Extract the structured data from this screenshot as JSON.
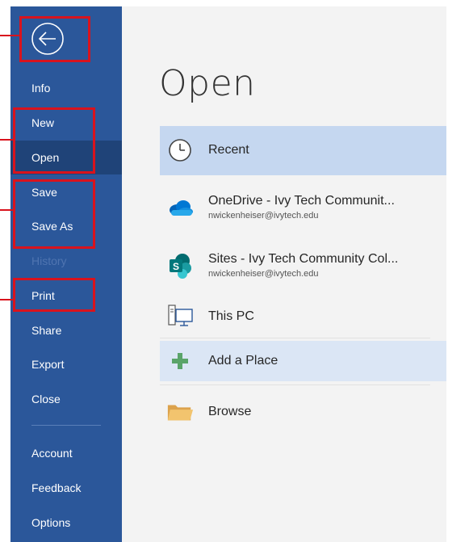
{
  "sidebar": {
    "back_label": "Back",
    "items": [
      {
        "label": "Info"
      },
      {
        "label": "New"
      },
      {
        "label": "Open"
      },
      {
        "label": "Save"
      },
      {
        "label": "Save As"
      },
      {
        "label": "History"
      },
      {
        "label": "Print"
      },
      {
        "label": "Share"
      },
      {
        "label": "Export"
      },
      {
        "label": "Close"
      },
      {
        "label": "Account"
      },
      {
        "label": "Feedback"
      },
      {
        "label": "Options"
      }
    ]
  },
  "main": {
    "title": "Open",
    "locations": [
      {
        "name": "Recent",
        "sub": "",
        "icon": "clock-icon"
      },
      {
        "name": "OneDrive - Ivy Tech Communit...",
        "sub": "nwickenheiser@ivytech.edu",
        "icon": "onedrive-cloud-icon"
      },
      {
        "name": "Sites - Ivy Tech Community Col...",
        "sub": "nwickenheiser@ivytech.edu",
        "icon": "sharepoint-icon"
      },
      {
        "name": "This PC",
        "sub": "",
        "icon": "computer-icon"
      },
      {
        "name": "Add a Place",
        "sub": "",
        "icon": "plus-icon"
      },
      {
        "name": "Browse",
        "sub": "",
        "icon": "folder-icon"
      }
    ]
  },
  "colors": {
    "sidebar": "#2b579a",
    "sidebar_active": "#1f4378",
    "highlight": "#d9131d",
    "selected_row": "#c5d7f0"
  }
}
